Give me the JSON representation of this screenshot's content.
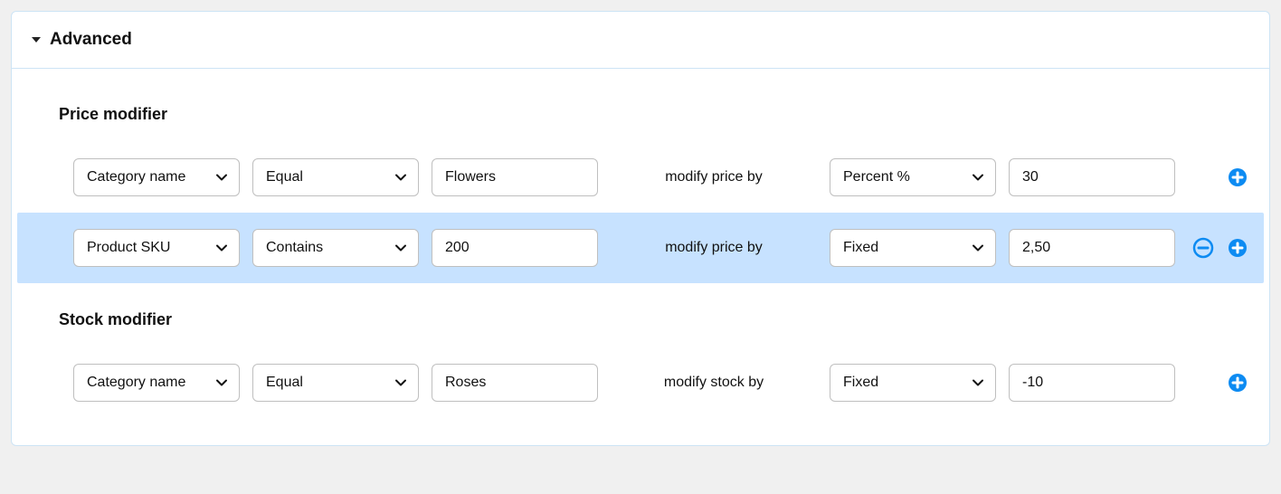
{
  "header": {
    "title": "Advanced"
  },
  "sections": {
    "price": {
      "label": "Price modifier",
      "mid_text": "modify price by",
      "rows": [
        {
          "field": "Category name",
          "operator": "Equal",
          "value": "Flowers",
          "type": "Percent %",
          "amount": "30",
          "highlighted": false,
          "can_remove": false
        },
        {
          "field": "Product SKU",
          "operator": "Contains",
          "value": "200",
          "type": "Fixed",
          "amount": "2,50",
          "highlighted": true,
          "can_remove": true
        }
      ]
    },
    "stock": {
      "label": "Stock modifier",
      "mid_text": "modify stock by",
      "rows": [
        {
          "field": "Category name",
          "operator": "Equal",
          "value": "Roses",
          "type": "Fixed",
          "amount": "-10",
          "highlighted": false,
          "can_remove": false
        }
      ]
    }
  }
}
